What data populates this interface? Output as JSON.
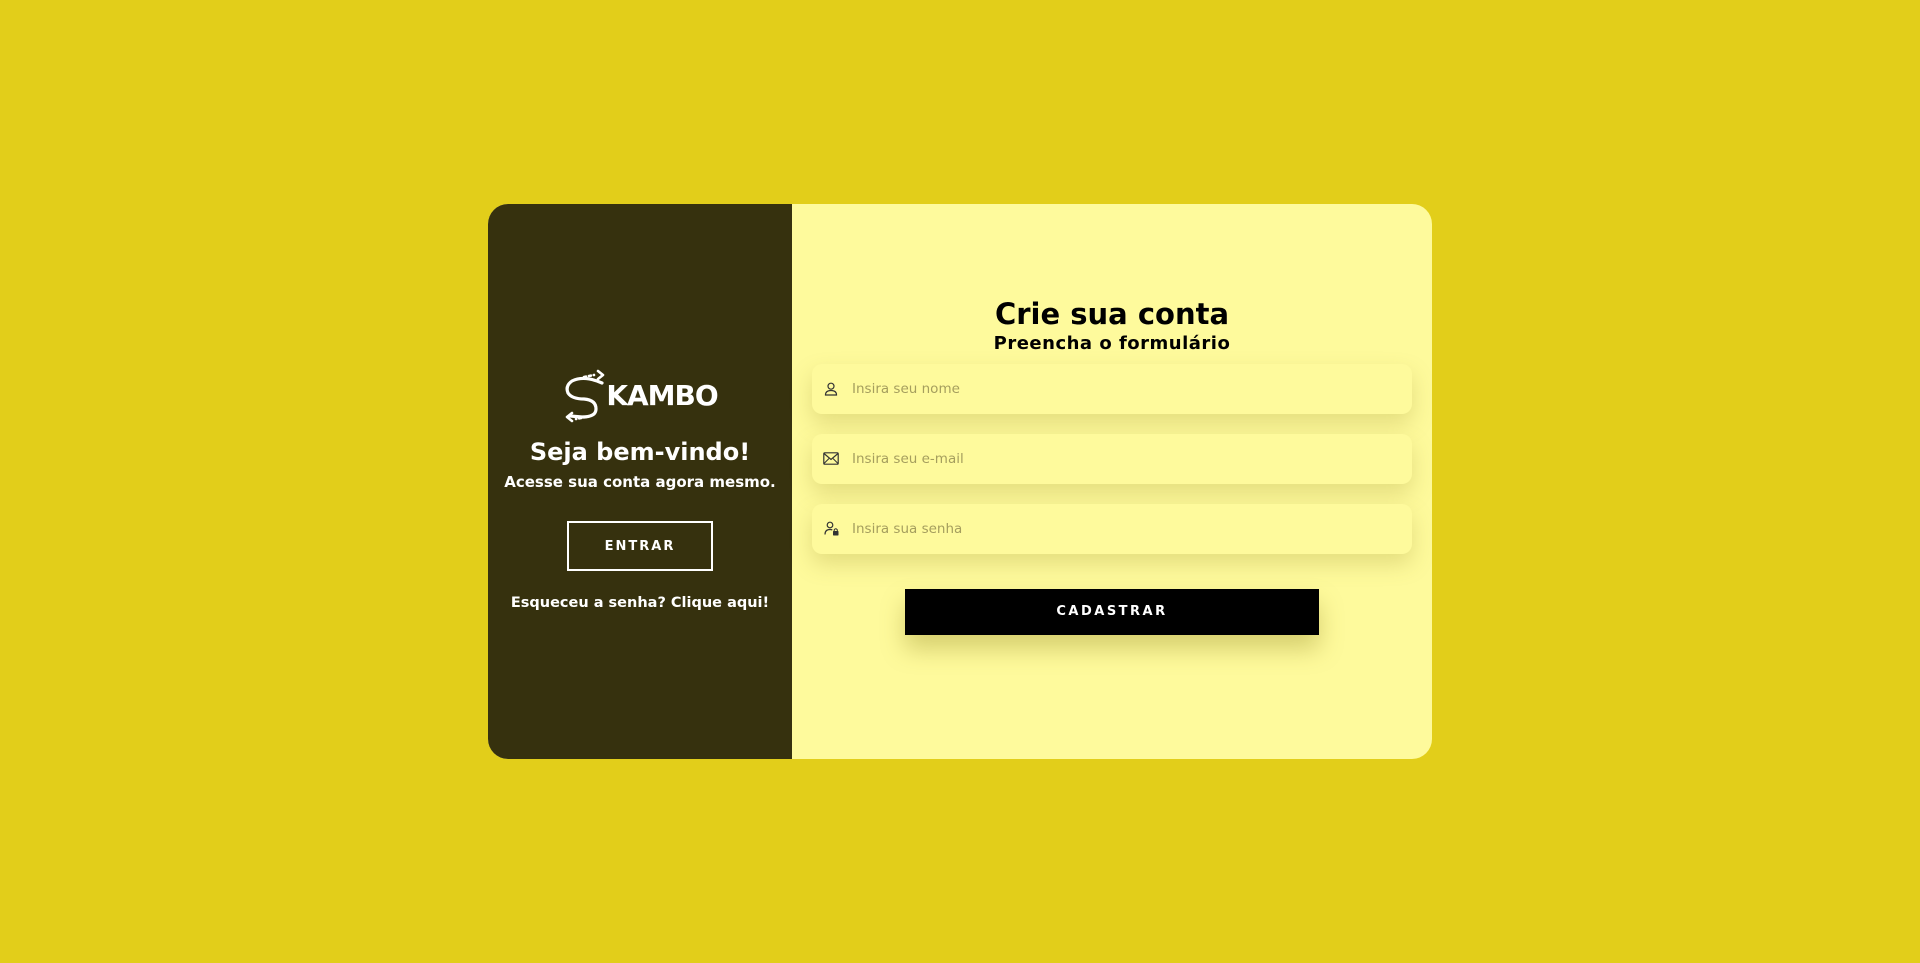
{
  "colors": {
    "page_background": "#e2ce1a",
    "left_panel": "#36310e",
    "right_panel": "#fefa9c",
    "button_dark": "#000000",
    "text_light": "#ffffff"
  },
  "brand": {
    "logo_text": "KAMBO",
    "logo_icon": "s-arrows-logo-icon"
  },
  "left_panel": {
    "heading": "Seja bem-vindo!",
    "subheading": "Acesse sua conta agora mesmo.",
    "login_button": "ENTRAR",
    "forgot_link": "Esqueceu a senha? Clique aqui!"
  },
  "form": {
    "title": "Crie sua conta",
    "subtitle": "Preencha o formulário",
    "fields": [
      {
        "icon": "user-icon",
        "placeholder": "Insira seu nome",
        "value": ""
      },
      {
        "icon": "envelope-icon",
        "placeholder": "Insira seu e-mail",
        "value": ""
      },
      {
        "icon": "user-lock-icon",
        "placeholder": "Insira sua senha",
        "value": ""
      }
    ],
    "submit_button": "CADASTRAR"
  }
}
